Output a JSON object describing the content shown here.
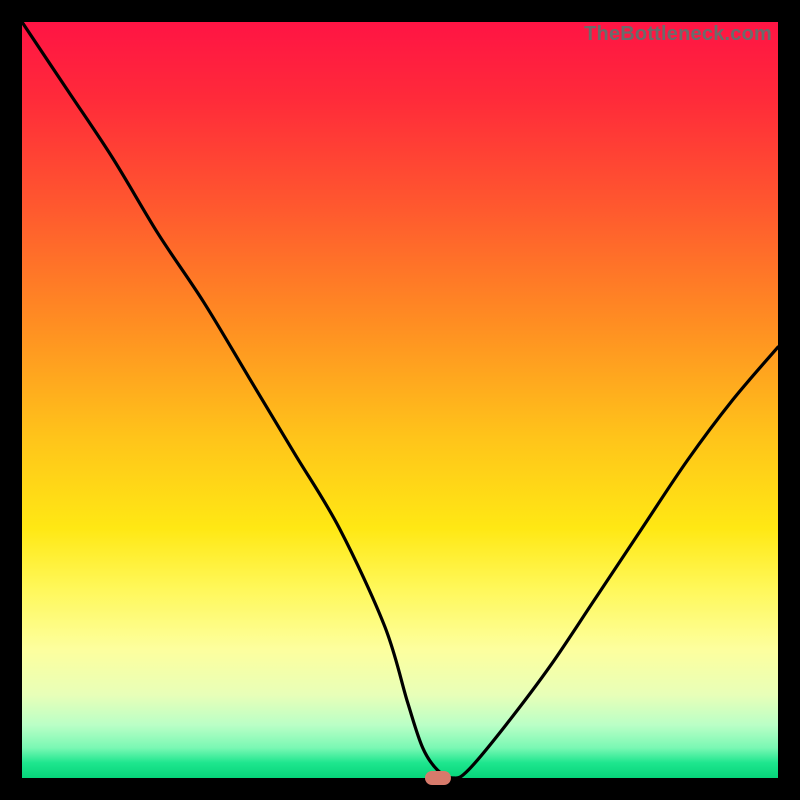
{
  "watermark": "TheBottleneck.com",
  "chart_data": {
    "type": "line",
    "title": "",
    "xlabel": "",
    "ylabel": "",
    "xlim": [
      0,
      100
    ],
    "ylim": [
      0,
      100
    ],
    "series": [
      {
        "name": "curve",
        "x": [
          0,
          6,
          12,
          18,
          24,
          30,
          36,
          42,
          48,
          51,
          53,
          55,
          57,
          59,
          64,
          70,
          76,
          82,
          88,
          94,
          100
        ],
        "y": [
          100,
          91,
          82,
          72,
          63,
          53,
          43,
          33,
          20,
          10,
          4,
          1,
          0,
          1,
          7,
          15,
          24,
          33,
          42,
          50,
          57
        ]
      }
    ],
    "marker": {
      "x": 55,
      "y": 0,
      "color": "#d77a6b"
    },
    "gradient_stops": [
      {
        "pos": 0,
        "color": "#ff1444"
      },
      {
        "pos": 50,
        "color": "#ff8e22"
      },
      {
        "pos": 75,
        "color": "#fff85a"
      },
      {
        "pos": 100,
        "color": "#06d47a"
      }
    ]
  }
}
